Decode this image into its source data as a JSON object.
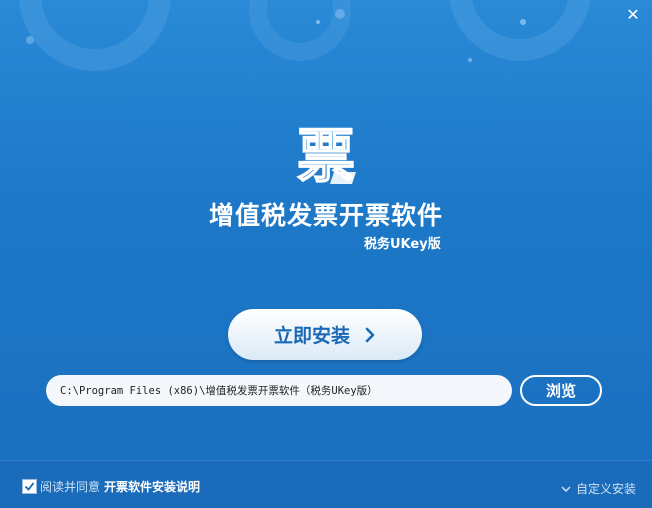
{
  "window": {
    "close_icon": "✕"
  },
  "branding": {
    "logo_glyph": "票",
    "product_title": "增值税发票开票软件",
    "edition": "税务UKey版"
  },
  "install": {
    "button_label": "立即安装"
  },
  "path": {
    "value": "C:\\Program Files (x86)\\增值税发票开票软件（税务UKey版）"
  },
  "browse": {
    "label": "浏览"
  },
  "footer": {
    "agree_checked": true,
    "agree_text": "阅读并同意",
    "agree_link": "开票软件安装说明",
    "custom_install": "自定义安装"
  },
  "colors": {
    "background": "#1d78c8",
    "button_text": "#1a69b6",
    "footer": "#1a6cba"
  }
}
